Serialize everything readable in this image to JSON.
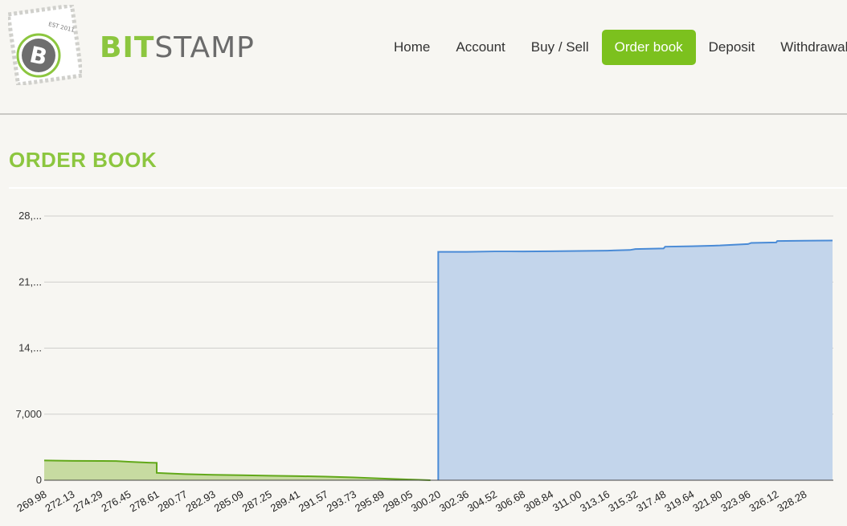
{
  "brand": {
    "part1": "BIT",
    "part2": "STAMP",
    "stamp_text": "EST 2011"
  },
  "colors": {
    "accent": "#8cc63f",
    "nav_active": "#7cc11e",
    "bids_line": "#62a81a",
    "bids_fill": "#c7dba1",
    "asks_line": "#4a8bd6",
    "asks_fill": "#c3d5eb"
  },
  "icons": {
    "logo": "bitcoin-stamp-icon"
  },
  "nav": {
    "items": [
      {
        "label": "Home",
        "active": false
      },
      {
        "label": "Account",
        "active": false
      },
      {
        "label": "Buy / Sell",
        "active": false
      },
      {
        "label": "Order book",
        "active": true
      },
      {
        "label": "Deposit",
        "active": false
      },
      {
        "label": "Withdrawal",
        "active": false
      }
    ]
  },
  "page": {
    "title": "ORDER BOOK"
  },
  "chart_data": {
    "type": "area",
    "title": "",
    "xlabel": "",
    "ylabel": "",
    "ylim": [
      0,
      28000
    ],
    "xlim": [
      269.98,
      330.44
    ],
    "grid": true,
    "y_ticks": [
      {
        "value": 0,
        "label": "0"
      },
      {
        "value": 7000,
        "label": "7,000"
      },
      {
        "value": 14000,
        "label": "14,..."
      },
      {
        "value": 21000,
        "label": "21,..."
      },
      {
        "value": 28000,
        "label": "28,..."
      }
    ],
    "x_tick_labels": [
      "269.98",
      "272.13",
      "274.29",
      "276.45",
      "278.61",
      "280.77",
      "282.93",
      "285.09",
      "287.25",
      "289.41",
      "291.57",
      "293.73",
      "295.89",
      "298.05",
      "300.20",
      "302.36",
      "304.52",
      "306.68",
      "308.84",
      "311.00",
      "313.16",
      "315.32",
      "317.48",
      "319.64",
      "321.80",
      "323.96",
      "326.12",
      "328.28"
    ],
    "series": [
      {
        "points": [
          [
            269.98,
            2100
          ],
          [
            271.0,
            2070
          ],
          [
            272.13,
            2050
          ],
          [
            274.29,
            2040
          ],
          [
            275.5,
            2030
          ],
          [
            276.45,
            1960
          ],
          [
            277.3,
            1900
          ],
          [
            278.0,
            1860
          ],
          [
            278.61,
            1840
          ],
          [
            278.61,
            780
          ],
          [
            279.5,
            720
          ],
          [
            280.77,
            650
          ],
          [
            282.93,
            570
          ],
          [
            285.09,
            530
          ],
          [
            287.25,
            480
          ],
          [
            289.41,
            440
          ],
          [
            291.57,
            380
          ],
          [
            293.73,
            300
          ],
          [
            295.89,
            180
          ],
          [
            298.05,
            70
          ],
          [
            299.6,
            0
          ]
        ]
      },
      {
        "points": [
          [
            300.2,
            0
          ],
          [
            300.2,
            24200
          ],
          [
            302.36,
            24200
          ],
          [
            304.52,
            24250
          ],
          [
            306.68,
            24250
          ],
          [
            308.84,
            24270
          ],
          [
            311.0,
            24300
          ],
          [
            313.16,
            24330
          ],
          [
            314.9,
            24400
          ],
          [
            315.32,
            24500
          ],
          [
            317.48,
            24560
          ],
          [
            317.6,
            24750
          ],
          [
            319.64,
            24800
          ],
          [
            321.8,
            24880
          ],
          [
            323.96,
            25030
          ],
          [
            324.2,
            25150
          ],
          [
            326.12,
            25200
          ],
          [
            326.2,
            25350
          ],
          [
            328.28,
            25380
          ],
          [
            330.44,
            25400
          ]
        ]
      }
    ]
  }
}
